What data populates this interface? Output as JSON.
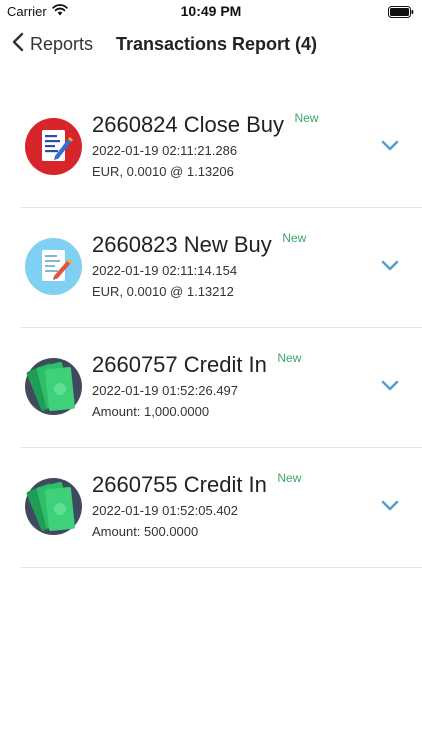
{
  "status_bar": {
    "carrier": "Carrier",
    "time": "10:49 PM"
  },
  "nav": {
    "back_label": "Reports",
    "title": "Transactions Report (4)"
  },
  "colors": {
    "accent": "#5a9fd4",
    "new_badge": "#3aa86b"
  },
  "transactions": [
    {
      "title": "2660824 Close Buy",
      "badge": "New",
      "date": "2022-01-19 02:11:21.286",
      "detail": "EUR, 0.0010 @ 1.13206",
      "icon": "document-red-icon"
    },
    {
      "title": "2660823 New Buy",
      "badge": "New",
      "date": "2022-01-19 02:11:14.154",
      "detail": "EUR, 0.0010 @ 1.13212",
      "icon": "document-blue-icon"
    },
    {
      "title": "2660757 Credit In",
      "badge": "New",
      "date": "2022-01-19 01:52:26.497",
      "detail": "Amount: 1,000.0000",
      "icon": "money-icon"
    },
    {
      "title": "2660755 Credit In",
      "badge": "New",
      "date": "2022-01-19 01:52:05.402",
      "detail": "Amount: 500.0000",
      "icon": "money-icon"
    }
  ]
}
